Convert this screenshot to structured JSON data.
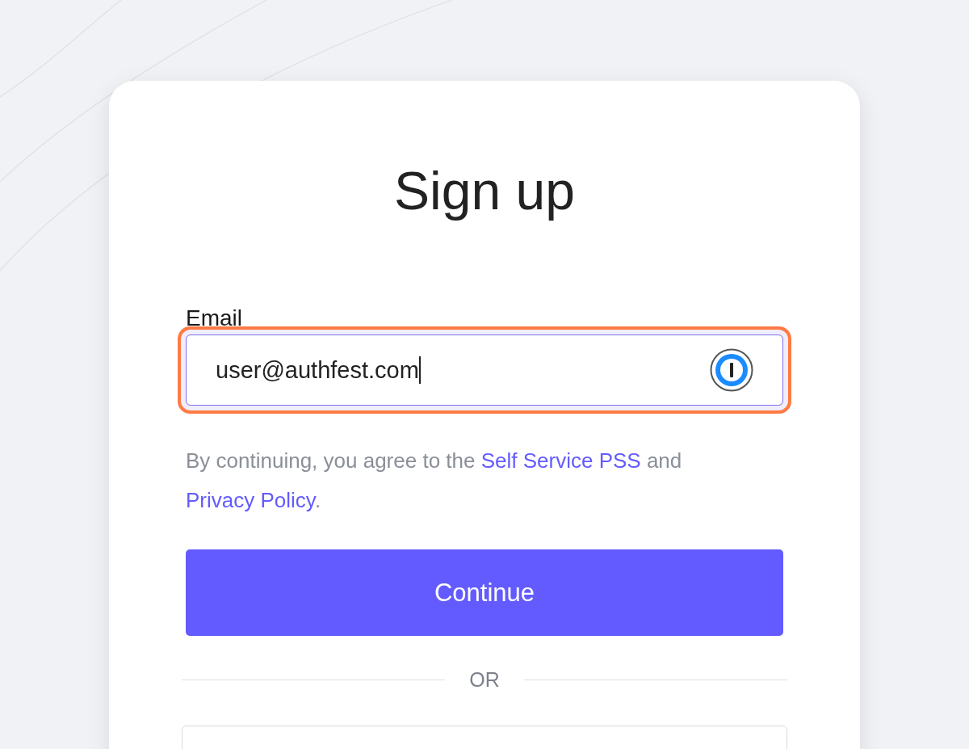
{
  "title": "Sign up",
  "email": {
    "label": "Email",
    "value": "user@authfest.com",
    "focused": true
  },
  "terms": {
    "prefix": "By continuing, you agree to the ",
    "link_1": "Self Service PSS",
    "middle": " and",
    "link_2": "Privacy Policy",
    "suffix": "."
  },
  "continue_button": "Continue",
  "divider": "OR"
}
